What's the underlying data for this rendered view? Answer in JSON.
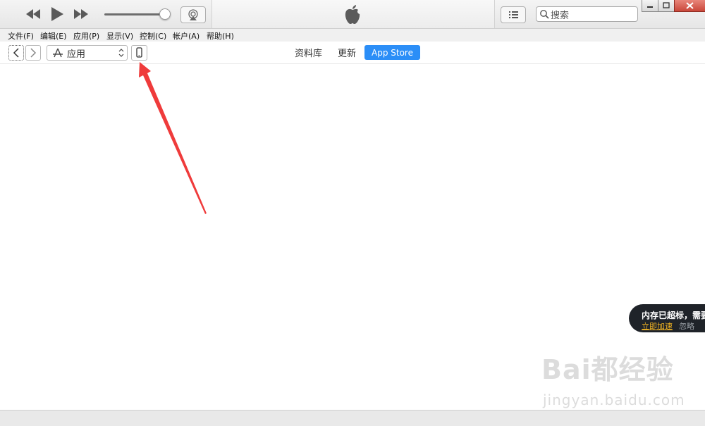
{
  "titlebar": {
    "search_placeholder": "搜索"
  },
  "menu": [
    {
      "label": "文件(F)"
    },
    {
      "label": "编辑(E)"
    },
    {
      "label": "应用(P)"
    },
    {
      "label": "显示(V)"
    },
    {
      "label": "控制(C)"
    },
    {
      "label": "帐户(A)"
    },
    {
      "label": "帮助(H)"
    }
  ],
  "toolbar": {
    "media_kind": "应用",
    "tabs": [
      {
        "label": "资料库"
      },
      {
        "label": "更新"
      },
      {
        "label": "App Store",
        "active": true
      }
    ]
  },
  "colors": {
    "accent": "#2b8ef7",
    "annotation": "#ef3b3b"
  },
  "toast": {
    "title": "内存已超标，需要",
    "action": "立即加速",
    "dismiss": "忽略"
  },
  "watermark": {
    "main": "Bai都经验",
    "sub": "jingyan.baidu.com"
  }
}
